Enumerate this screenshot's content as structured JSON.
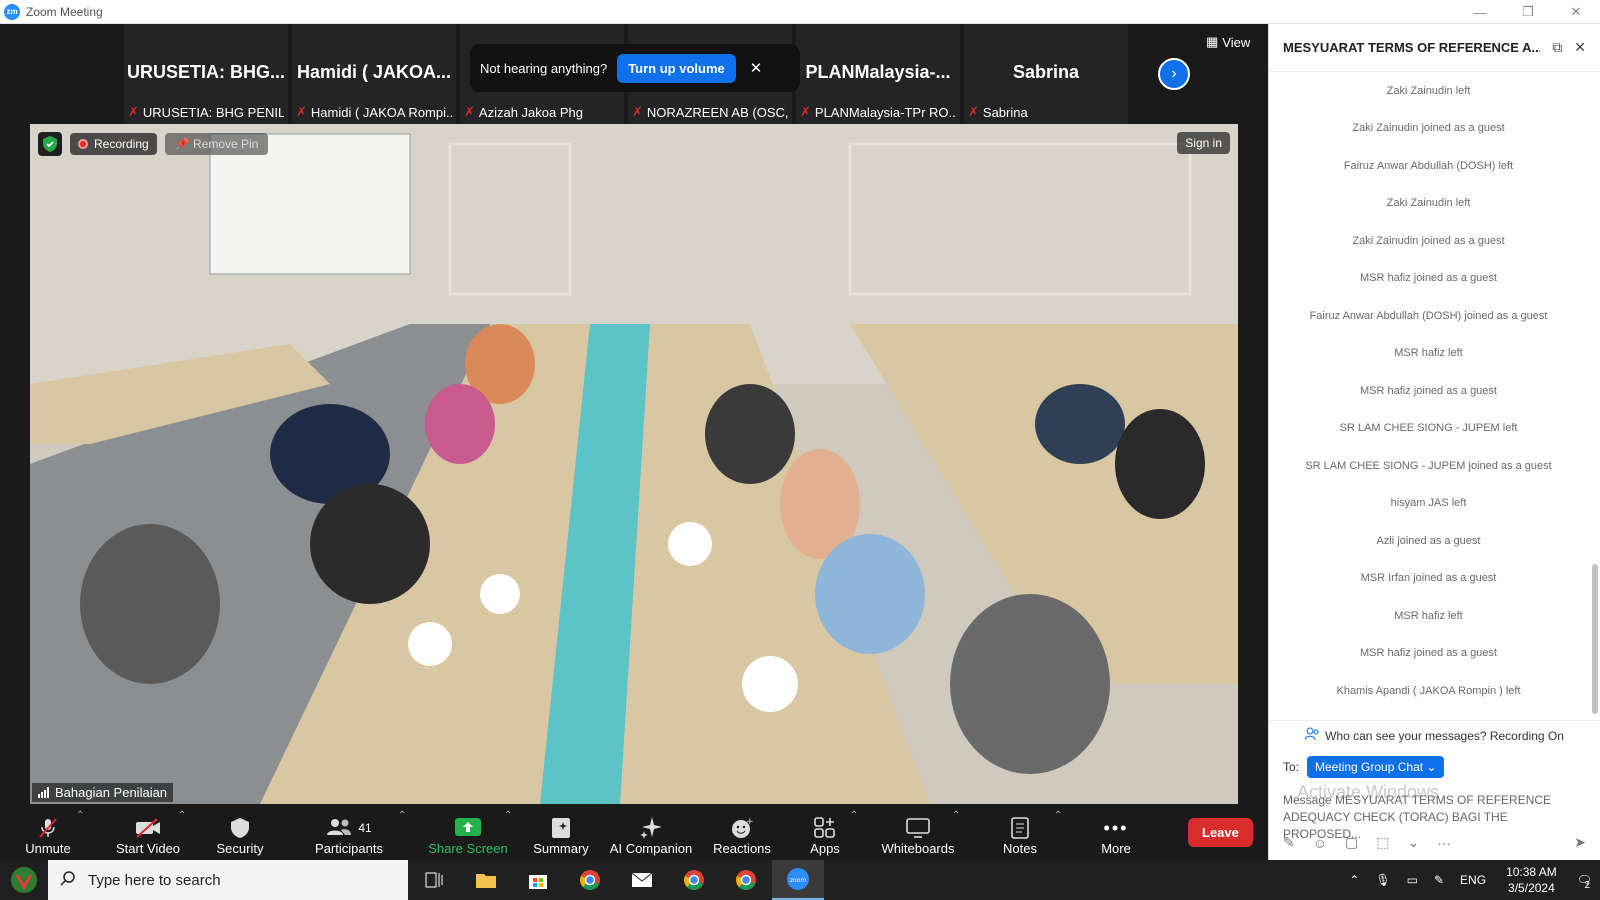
{
  "window": {
    "title": "Zoom Meeting",
    "logo_text": "zm"
  },
  "strip": {
    "tiles": [
      {
        "big": "URUSETIA: BHG...",
        "small": "URUSETIA: BHG PENIL..."
      },
      {
        "big": "Hamidi ( JAKOA...",
        "small": "Hamidi ( JAKOA Rompi..."
      },
      {
        "big": "",
        "small": "Azizah Jakoa Phg"
      },
      {
        "big": "",
        "small": "NORAZREEN AB (OSC,..."
      },
      {
        "big": "PLANMalaysia-...",
        "small": "PLANMalaysia-TPr RO..."
      },
      {
        "big": "Sabrina",
        "small": "Sabrina"
      }
    ],
    "banner_text": "Not hearing anything?",
    "banner_button": "Turn up volume",
    "view_label": "View"
  },
  "video": {
    "recording_label": "Recording",
    "remove_pin_label": "Remove Pin",
    "sign_in_label": "Sign in",
    "speaker_name": "Bahagian Penilaian"
  },
  "toolbar": {
    "unmute": "Unmute",
    "start_video": "Start Video",
    "security": "Security",
    "participants": "Participants",
    "participants_count": "41",
    "share_screen": "Share Screen",
    "summary": "Summary",
    "ai_companion": "AI Companion",
    "reactions": "Reactions",
    "apps": "Apps",
    "whiteboards": "Whiteboards",
    "notes": "Notes",
    "more": "More",
    "leave": "Leave"
  },
  "chat": {
    "title": "MESYUARAT TERMS OF REFERENCE A...",
    "messages": [
      "Zaki Zainudin left",
      "Zaki Zainudin joined as a guest",
      "Fairuz Anwar Abdullah (DOSH) left",
      "Zaki Zainudin left",
      "Zaki Zainudin joined as a guest",
      "MSR hafiz joined as a guest",
      "Fairuz Anwar Abdullah (DOSH) joined as a guest",
      "MSR hafiz left",
      "MSR hafiz joined as a guest",
      "SR LAM CHEE SIONG - JUPEM left",
      "SR LAM CHEE SIONG - JUPEM joined as a guest",
      "hisyam JAS left",
      "Azli joined as a guest",
      "MSR Irfan joined as a guest",
      "MSR hafiz left",
      "MSR hafiz joined as a guest",
      "Khamis Apandi ( JAKOA Rompin ) left"
    ],
    "who_can_see": "Who can see your messages? Recording On",
    "to_label": "To:",
    "to_value": "Meeting Group Chat",
    "draft": "Message MESYUARAT TERMS OF REFERENCE ADEQUACY CHECK (TORAC) BAGI THE PROPOSED...",
    "watermark": "Activate Windows"
  },
  "taskbar": {
    "search_placeholder": "Type here to search",
    "lang": "ENG",
    "time": "10:38 AM",
    "date": "3/5/2024",
    "notif_count": "2"
  }
}
